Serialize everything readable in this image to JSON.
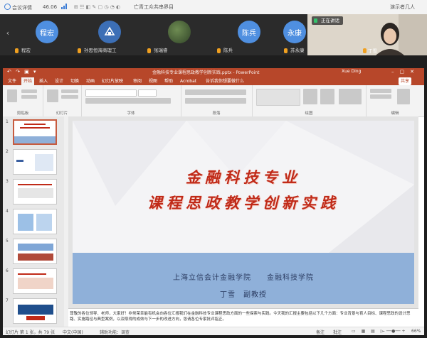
{
  "topbar": {
    "meeting_app": "会议详情",
    "signal": "46.06",
    "ticker": "亡青工众共串界目",
    "right": "演示者几人"
  },
  "participants": [
    {
      "avatar_text": "程宏",
      "name": "程宏",
      "color": "#4f8fe0"
    },
    {
      "avatar_text": "",
      "name": "孙思恒海商理工",
      "color": "#3c6fb6"
    },
    {
      "avatar_text": "",
      "name": "张瑞睿",
      "color": "#4b6b3a"
    },
    {
      "avatar_text": "陈兵",
      "name": "陈兵",
      "color": "#4f8fe0"
    },
    {
      "avatar_text": "永康",
      "name": "苏永康",
      "color": "#4f8fe0"
    }
  ],
  "selfview": {
    "speaking_label": "正在讲话",
    "name": "丁雪"
  },
  "powerpoint": {
    "title": "金融科技专业课程思政教学创新实践.pptx - PowerPoint",
    "user": "Xue Ding",
    "qat": "↶ ↷ ▣ ▾",
    "tabs": [
      "文件",
      "开始",
      "插入",
      "设计",
      "切换",
      "动画",
      "幻灯片放映",
      "审阅",
      "视图",
      "帮助",
      "Acrobat",
      "告诉我你想要做什么"
    ],
    "active_tab": "开始",
    "share_label": "共享",
    "ribbon_groups": [
      "剪贴板",
      "幻灯片",
      "字体",
      "段落",
      "绘图",
      "编辑"
    ]
  },
  "slide": {
    "title_line1": "金融科技专业",
    "title_line2": "课程思政教学创新实践",
    "institution": "上海立信会计金融学院　　金融科技学院",
    "presenter": "丁雪　副教授"
  },
  "thumbnails": [
    {
      "num": "1",
      "selected": true
    },
    {
      "num": "2",
      "selected": false
    },
    {
      "num": "3",
      "selected": false
    },
    {
      "num": "4",
      "selected": false
    },
    {
      "num": "5",
      "selected": false
    },
    {
      "num": "6",
      "selected": false
    },
    {
      "num": "7",
      "selected": false
    }
  ],
  "notes": {
    "text": "尊敬的各位领导、老师，大家好！非常荣幸能有机会向各位汇报我们在金融科技专业课程思政方面的一些探索与实践。今天我的汇报主要包括以下几个方面：专业背景与育人目标、课程思政的设计思路、实施路径与典型案例，以及取得的成效与下一步的改进方向，恳请各位专家批评指正。"
  },
  "status": {
    "slide_count": "幻灯片 第 1 张，共 79 张",
    "language": "中文(中国)",
    "accessibility": "辅助功能：调查",
    "notes_btn": "备注",
    "comments_btn": "批注",
    "zoom": "66%"
  }
}
